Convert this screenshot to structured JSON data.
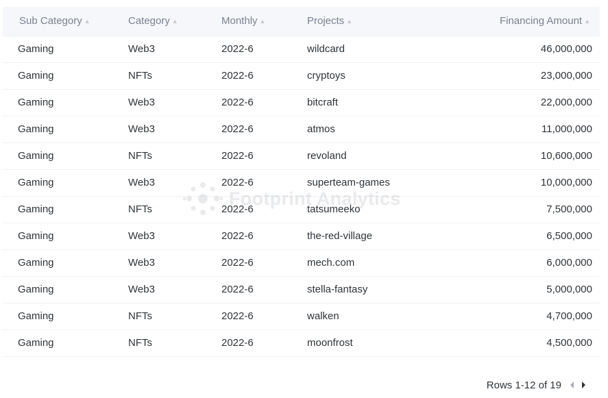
{
  "table": {
    "columns": [
      {
        "label": "Sub Category"
      },
      {
        "label": "Category"
      },
      {
        "label": "Monthly"
      },
      {
        "label": "Projects"
      },
      {
        "label": "Financing Amount"
      }
    ],
    "rows": [
      [
        "Gaming",
        "Web3",
        "2022-6",
        "wildcard",
        "46,000,000"
      ],
      [
        "Gaming",
        "NFTs",
        "2022-6",
        "cryptoys",
        "23,000,000"
      ],
      [
        "Gaming",
        "Web3",
        "2022-6",
        "bitcraft",
        "22,000,000"
      ],
      [
        "Gaming",
        "Web3",
        "2022-6",
        "atmos",
        "11,000,000"
      ],
      [
        "Gaming",
        "NFTs",
        "2022-6",
        "revoland",
        "10,600,000"
      ],
      [
        "Gaming",
        "Web3",
        "2022-6",
        "superteam-games",
        "10,000,000"
      ],
      [
        "Gaming",
        "NFTs",
        "2022-6",
        "tatsumeeko",
        "7,500,000"
      ],
      [
        "Gaming",
        "Web3",
        "2022-6",
        "the-red-village",
        "6,500,000"
      ],
      [
        "Gaming",
        "Web3",
        "2022-6",
        "mech.com",
        "6,000,000"
      ],
      [
        "Gaming",
        "Web3",
        "2022-6",
        "stella-fantasy",
        "5,000,000"
      ],
      [
        "Gaming",
        "NFTs",
        "2022-6",
        "walken",
        "4,700,000"
      ],
      [
        "Gaming",
        "NFTs",
        "2022-6",
        "moonfrost",
        "4,500,000"
      ]
    ]
  },
  "watermark": {
    "text": "Footprint Analytics"
  },
  "pagination": {
    "label": "Rows 1-12 of 19",
    "prev_icon": "caret-left-icon",
    "next_icon": "caret-right-icon"
  },
  "colors": {
    "header_bg": "#f6f7fb",
    "header_text": "#7b818e",
    "body_text": "#2e3338",
    "row_border": "#eef0f4",
    "prev_arrow": "#a9adb5",
    "next_arrow": "#2e3338"
  }
}
